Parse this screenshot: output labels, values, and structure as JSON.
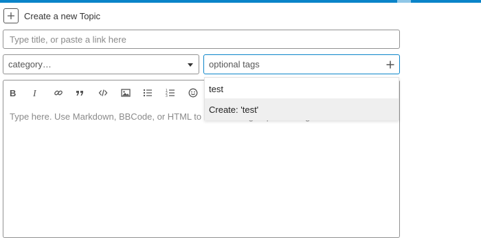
{
  "header": {
    "title": "Create a new Topic"
  },
  "title_field": {
    "placeholder": "Type title, or paste a link here",
    "value": ""
  },
  "category": {
    "label": "category…"
  },
  "tags": {
    "placeholder": "optional tags"
  },
  "tag_dropdown": {
    "filter_value": "test",
    "create_option": "Create: 'test'"
  },
  "editor": {
    "toolbar": [
      "bold-icon",
      "italic-icon",
      "link-icon",
      "blockquote-icon",
      "code-icon",
      "image-icon",
      "bullet-list-icon",
      "numbered-list-icon",
      "emoji-icon"
    ],
    "placeholder": "Type here. Use Markdown, BBCode, or HTML to format. Drag or paste images."
  },
  "colors": {
    "accent": "#0a84c9",
    "border": "#919191",
    "placeholder_text": "#8a8a8a"
  }
}
